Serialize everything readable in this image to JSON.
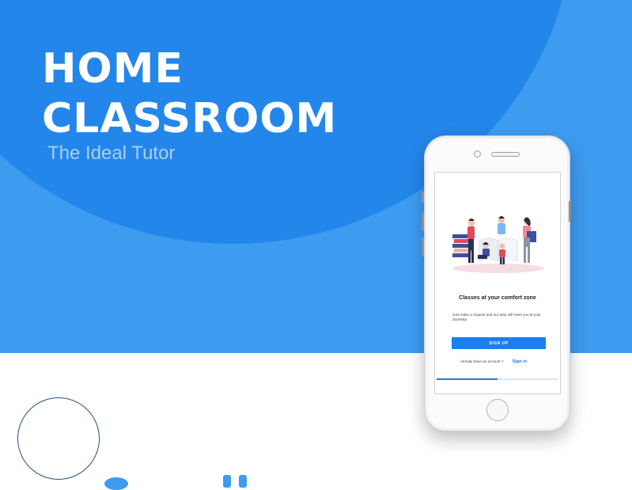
{
  "hero": {
    "title_line1": "HOME",
    "title_line2": "CLASSROOM",
    "subtitle": "The Ideal Tutor"
  },
  "phone_screen": {
    "illustration_icon": "students-with-books-illustration",
    "headline": "Classes at your comfort zone",
    "description": "Just make a request and our tutor will meet you at your doorstep.",
    "signup_label": "SIGN UP",
    "account_prompt": "Already have an account ?",
    "signin_label": "Sign in",
    "onboarding_progress_fraction": 0.5
  },
  "colors": {
    "hero_background": "#3d9bf0",
    "hero_circle": "#2386ea",
    "accent": "#1a7ff0",
    "circle_outline": "#2a4e82"
  }
}
